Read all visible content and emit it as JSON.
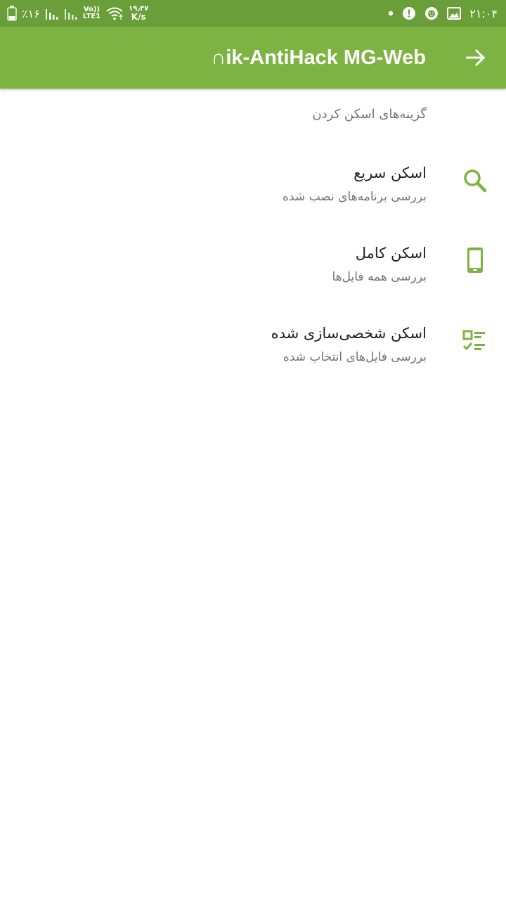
{
  "status_bar": {
    "battery_text": "٪۱۶",
    "volte_label": "Vo))",
    "lte_label": "LTE1",
    "net_speed_value": "۱۹٫۳۷",
    "net_speed_unit": "K/s",
    "time": "۲۱:۰۴"
  },
  "app_bar": {
    "title": "∩ik-AntiHack MG-Web"
  },
  "content": {
    "section_header": "گزینه‌های اسکن کردن",
    "options": [
      {
        "title": "اسکن سریع",
        "subtitle": "بررسی برنامه‌های نصب شده",
        "icon": "search-icon"
      },
      {
        "title": "اسکن کامل",
        "subtitle": "بررسی همه فایل‌ها",
        "icon": "phone-icon"
      },
      {
        "title": "اسکن شخصی‌سازی شده",
        "subtitle": "بررسی فایل‌های انتخاب شده",
        "icon": "checklist-icon"
      }
    ]
  },
  "colors": {
    "status_bar": "#6a9e38",
    "app_bar": "#7cb342",
    "accent": "#7cb342"
  }
}
